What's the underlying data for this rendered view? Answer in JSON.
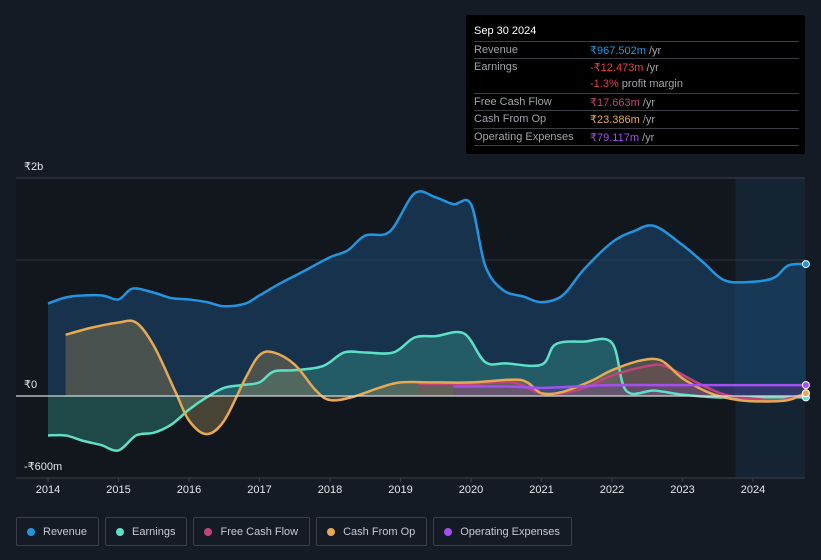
{
  "tooltip": {
    "date": "Sep 30 2024",
    "rows": [
      {
        "label": "Revenue",
        "value": "₹967.502m",
        "unit": " /yr",
        "color": "#2394df"
      },
      {
        "label": "Earnings",
        "value": "-₹12.473m",
        "unit": " /yr",
        "color": "#e64141"
      },
      {
        "label": "",
        "value": "-1.3%",
        "unit": " profit margin",
        "color": "#e64141"
      },
      {
        "label": "Free Cash Flow",
        "value": "₹17.663m",
        "unit": " /yr",
        "color": "#c2437b"
      },
      {
        "label": "Cash From Op",
        "value": "₹23.386m",
        "unit": " /yr",
        "color": "#e8a955"
      },
      {
        "label": "Operating Expenses",
        "value": "₹79.117m",
        "unit": " /yr",
        "color": "#a44ff0"
      }
    ]
  },
  "legend": [
    {
      "label": "Revenue",
      "color": "#2394df"
    },
    {
      "label": "Earnings",
      "color": "#5ee0c6"
    },
    {
      "label": "Free Cash Flow",
      "color": "#c2437b"
    },
    {
      "label": "Cash From Op",
      "color": "#e8a955"
    },
    {
      "label": "Operating Expenses",
      "color": "#a44ff0"
    }
  ],
  "chart_data": {
    "type": "area",
    "title": "",
    "xlabel": "",
    "ylabel": "",
    "y_unit": "₹b",
    "y_tick_labels": [
      "₹2b",
      "₹0",
      "-₹600m"
    ],
    "x_tick_labels": [
      "2014",
      "2015",
      "2016",
      "2017",
      "2018",
      "2019",
      "2020",
      "2021",
      "2022",
      "2023",
      "2024"
    ],
    "x_range": [
      2014,
      2024.75
    ],
    "ylim": [
      -0.6,
      1.6
    ],
    "highlight_from": 2023.75,
    "grid": true,
    "legend_position": "bottom-left",
    "series": [
      {
        "name": "Revenue",
        "color": "#2394df",
        "x": [
          2014,
          2014.3,
          2014.75,
          2015,
          2015.2,
          2015.5,
          2015.75,
          2016,
          2016.25,
          2016.5,
          2016.8,
          2017,
          2017.3,
          2017.6,
          2018,
          2018.25,
          2018.5,
          2018.85,
          2019.2,
          2019.5,
          2019.75,
          2020,
          2020.2,
          2020.45,
          2020.75,
          2021,
          2021.3,
          2021.6,
          2022,
          2022.3,
          2022.6,
          2023,
          2023.3,
          2023.6,
          2024,
          2024.3,
          2024.5,
          2024.75
        ],
        "values": [
          0.68,
          0.73,
          0.74,
          0.71,
          0.79,
          0.76,
          0.72,
          0.71,
          0.69,
          0.66,
          0.68,
          0.74,
          0.83,
          0.91,
          1.02,
          1.07,
          1.18,
          1.21,
          1.49,
          1.46,
          1.41,
          1.41,
          0.96,
          0.78,
          0.73,
          0.69,
          0.74,
          0.93,
          1.13,
          1.21,
          1.25,
          1.11,
          0.98,
          0.85,
          0.84,
          0.87,
          0.96,
          0.97
        ]
      },
      {
        "name": "Earnings",
        "color": "#5ee0c6",
        "x": [
          2014,
          2014.25,
          2014.5,
          2014.75,
          2015,
          2015.25,
          2015.5,
          2015.75,
          2016,
          2016.25,
          2016.5,
          2016.75,
          2017,
          2017.2,
          2017.5,
          2017.9,
          2018.2,
          2018.5,
          2018.9,
          2019.2,
          2019.5,
          2019.9,
          2020.2,
          2020.5,
          2021,
          2021.2,
          2021.6,
          2022,
          2022.2,
          2022.6,
          2023,
          2023.5,
          2024,
          2024.75
        ],
        "values": [
          -0.29,
          -0.29,
          -0.33,
          -0.36,
          -0.4,
          -0.29,
          -0.27,
          -0.21,
          -0.1,
          -0.01,
          0.06,
          0.08,
          0.1,
          0.18,
          0.19,
          0.22,
          0.32,
          0.32,
          0.32,
          0.43,
          0.44,
          0.46,
          0.25,
          0.24,
          0.23,
          0.38,
          0.4,
          0.39,
          0.04,
          0.04,
          0.01,
          -0.01,
          -0.01,
          -0.01
        ]
      },
      {
        "name": "Free Cash Flow",
        "color": "#c2437b",
        "x": [
          2019.25,
          2020,
          2020.6,
          2021,
          2021.5,
          2022,
          2022.5,
          2022.75,
          2023.2,
          2023.6,
          2024,
          2024.4,
          2024.75
        ],
        "values": [
          0.09,
          0.09,
          0.1,
          0.02,
          0.04,
          0.15,
          0.22,
          0.22,
          0.1,
          0.01,
          -0.02,
          -0.03,
          0.02
        ]
      },
      {
        "name": "Cash From Op",
        "color": "#e8a955",
        "x": [
          2014.25,
          2014.6,
          2015,
          2015.25,
          2015.5,
          2015.8,
          2016,
          2016.25,
          2016.5,
          2016.8,
          2017,
          2017.2,
          2017.5,
          2017.8,
          2018,
          2018.3,
          2018.7,
          2019,
          2019.5,
          2020,
          2020.6,
          2020.8,
          2021,
          2021.3,
          2021.7,
          2022,
          2022.4,
          2022.7,
          2023,
          2023.4,
          2023.8,
          2024.2,
          2024.5,
          2024.75
        ],
        "values": [
          0.45,
          0.5,
          0.54,
          0.54,
          0.37,
          0.04,
          -0.18,
          -0.28,
          -0.18,
          0.13,
          0.3,
          0.32,
          0.23,
          0.04,
          -0.03,
          -0.01,
          0.06,
          0.1,
          0.1,
          0.1,
          0.12,
          0.1,
          0.02,
          0.03,
          0.11,
          0.19,
          0.26,
          0.26,
          0.13,
          0.02,
          -0.03,
          -0.04,
          -0.03,
          0.02
        ]
      },
      {
        "name": "Operating Expenses",
        "color": "#a44ff0",
        "x": [
          2019.75,
          2020.5,
          2021,
          2021.5,
          2022,
          2023,
          2024,
          2024.75
        ],
        "values": [
          0.07,
          0.07,
          0.06,
          0.07,
          0.08,
          0.08,
          0.08,
          0.08
        ]
      }
    ]
  }
}
